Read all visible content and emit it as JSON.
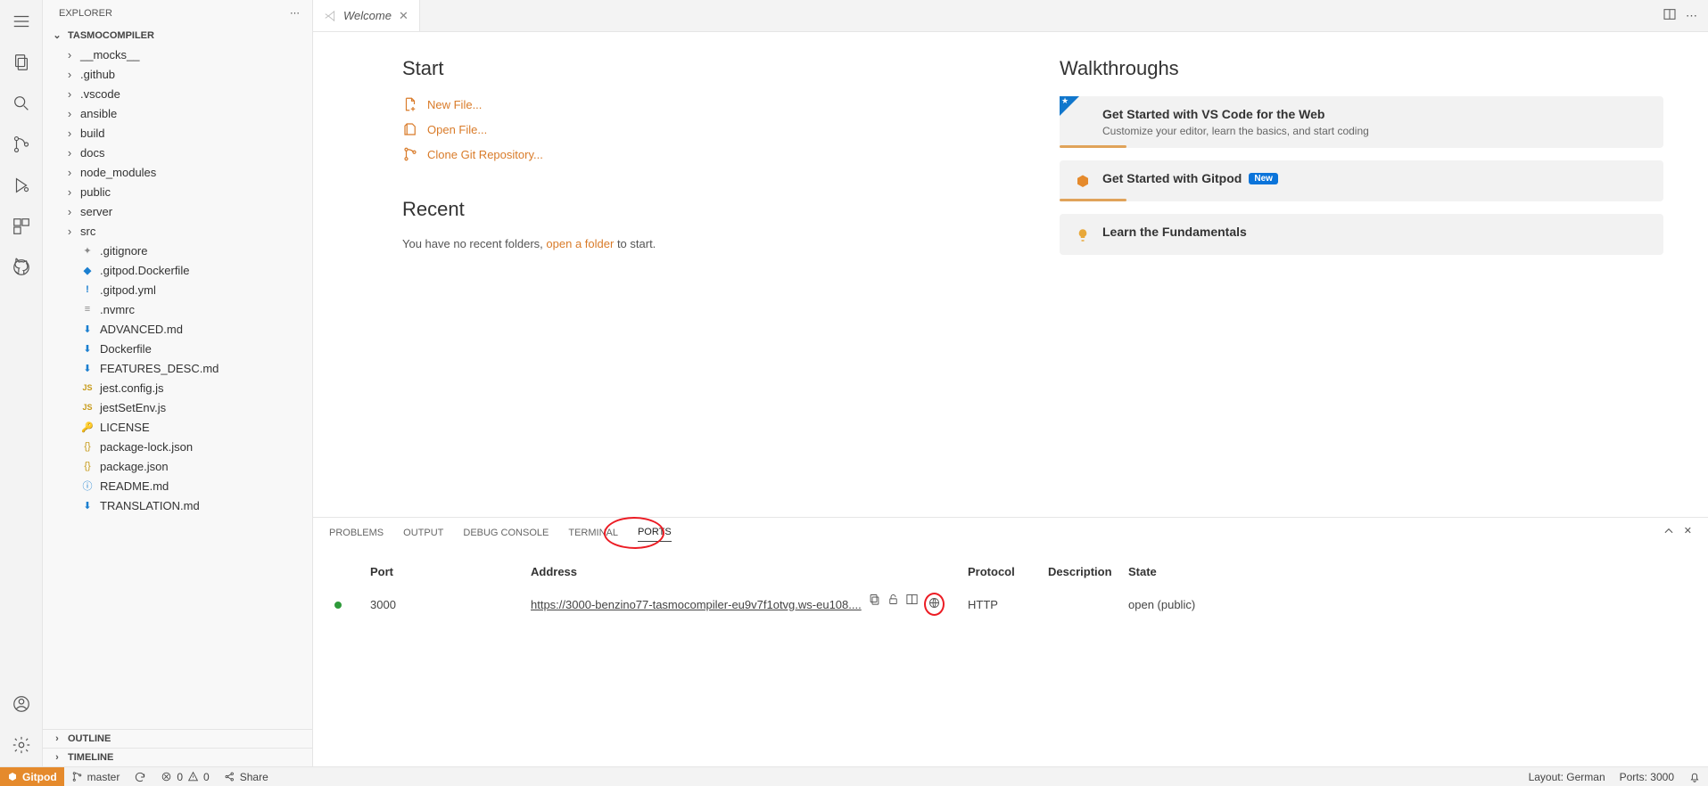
{
  "sidebar": {
    "header": "EXPLORER",
    "project": "TASMOCOMPILER",
    "folders": [
      "__mocks__",
      ".github",
      ".vscode",
      "ansible",
      "build",
      "docs",
      "node_modules",
      "public",
      "server",
      "src"
    ],
    "files": [
      {
        "icon": "cog",
        "name": ".gitignore"
      },
      {
        "icon": "blue-diamond",
        "name": ".gitpod.Dockerfile"
      },
      {
        "icon": "exclaim",
        "name": ".gitpod.yml"
      },
      {
        "icon": "lines",
        "name": ".nvmrc"
      },
      {
        "icon": "down",
        "name": "ADVANCED.md"
      },
      {
        "icon": "down",
        "name": "Dockerfile"
      },
      {
        "icon": "down",
        "name": "FEATURES_DESC.md"
      },
      {
        "icon": "js",
        "name": "jest.config.js"
      },
      {
        "icon": "js",
        "name": "jestSetEnv.js"
      },
      {
        "icon": "key",
        "name": "LICENSE"
      },
      {
        "icon": "json",
        "name": "package-lock.json"
      },
      {
        "icon": "json",
        "name": "package.json"
      },
      {
        "icon": "info",
        "name": "README.md"
      },
      {
        "icon": "down",
        "name": "TRANSLATION.md"
      }
    ],
    "outline": "OUTLINE",
    "timeline": "TIMELINE"
  },
  "tab": {
    "title": "Welcome"
  },
  "welcome": {
    "start_h": "Start",
    "links": {
      "new_file": "New File...",
      "open_file": "Open File...",
      "clone": "Clone Git Repository..."
    },
    "recent_h": "Recent",
    "recent_prefix": "You have no recent folders, ",
    "recent_link": "open a folder",
    "recent_suffix": " to start.",
    "walk_h": "Walkthroughs",
    "wt1_title": "Get Started with VS Code for the Web",
    "wt1_sub": "Customize your editor, learn the basics, and start coding",
    "wt2_title": "Get Started with Gitpod",
    "wt2_new": "New",
    "wt3_title": "Learn the Fundamentals"
  },
  "panel": {
    "tabs": {
      "problems": "PROBLEMS",
      "output": "OUTPUT",
      "debug": "DEBUG CONSOLE",
      "terminal": "TERMINAL",
      "ports": "PORTS"
    },
    "headers": {
      "port": "Port",
      "address": "Address",
      "protocol": "Protocol",
      "description": "Description",
      "state": "State"
    },
    "row": {
      "port": "3000",
      "address": "https://3000-benzino77-tasmocompiler-eu9v7f1otvg.ws-eu108....",
      "protocol": "HTTP",
      "state": "open (public)"
    }
  },
  "status": {
    "gitpod": "Gitpod",
    "branch": "master",
    "errors": "0",
    "warnings": "0",
    "share": "Share",
    "layout": "Layout: German",
    "ports": "Ports: 3000"
  }
}
